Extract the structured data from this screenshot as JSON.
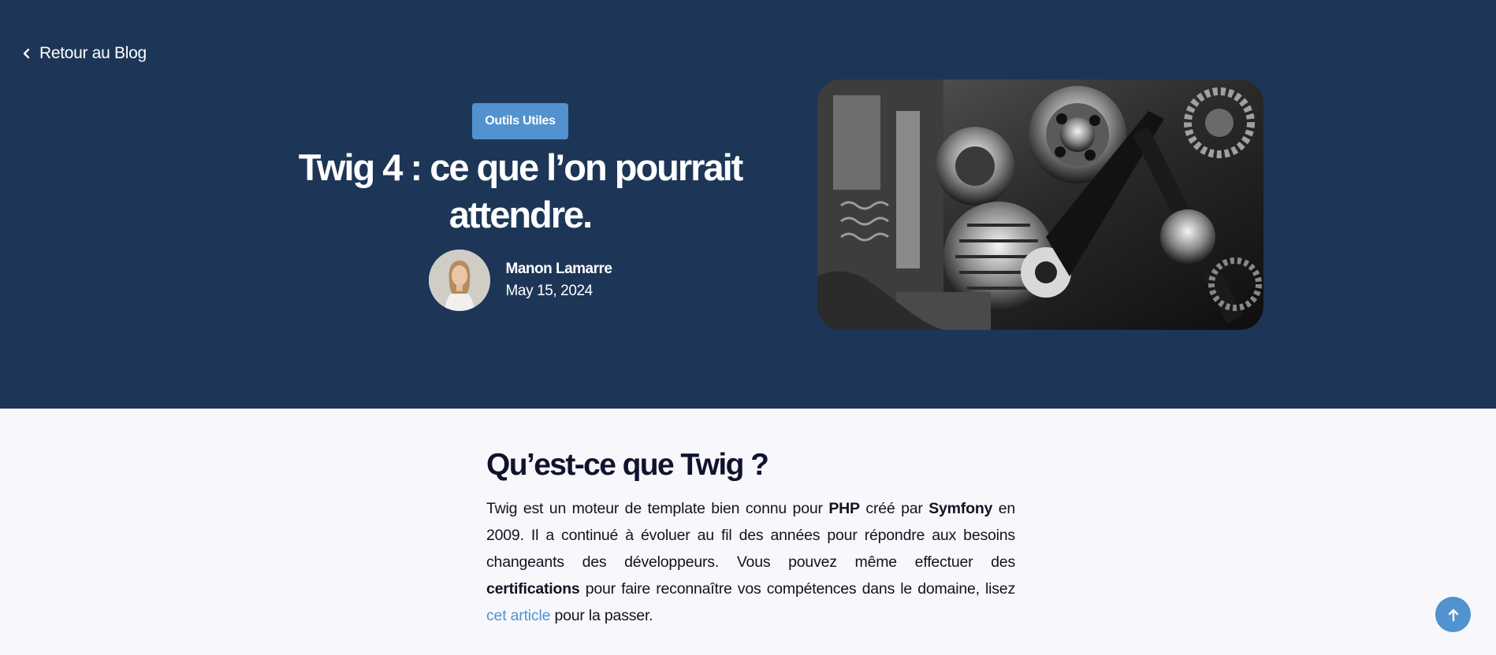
{
  "header": {
    "back_label": "Retour au Blog"
  },
  "post": {
    "category": "Outils Utiles",
    "title": "Twig 4 : ce que l’on pourrait attendre.",
    "author_name": "Manon Lamarre",
    "date": "May 15, 2024"
  },
  "article": {
    "heading": "Qu’est-ce que Twig ?",
    "p1": "Twig est un moteur de template bien connu pour ",
    "php": "PHP",
    "p2": " créé par ",
    "symfony": "Symfony",
    "p3": " en 2009. Il a continué à évoluer au fil des années pour répondre aux besoins changeants des développeurs. Vous pouvez même effectuer des ",
    "certifications": "certifications",
    "p4": " pour faire reconnaître vos compétences dans le domaine, lisez ",
    "link_text": "cet article",
    "p5": " pour la passer."
  },
  "icons": {
    "back": "chevron-left-icon",
    "scroll_top": "arrow-up-icon"
  },
  "colors": {
    "hero_bg": "#1d3657",
    "accent": "#5192cf",
    "page_bg": "#f8f8fc",
    "heading": "#10132d"
  }
}
